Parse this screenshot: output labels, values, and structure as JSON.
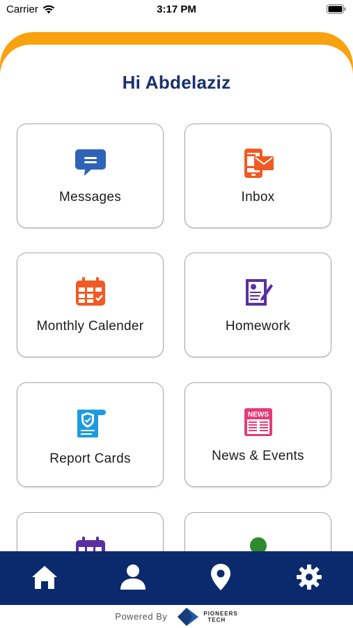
{
  "status_bar": {
    "carrier": "Carrier",
    "time": "3:17 PM"
  },
  "greeting": "Hi Abdelaziz",
  "tiles": [
    {
      "label": "Messages",
      "icon": "message-bubble-icon",
      "color": "#2f63b8"
    },
    {
      "label": "Inbox",
      "icon": "phone-mail-icon",
      "color": "#f15a22"
    },
    {
      "label": "Monthly Calender",
      "icon": "calendar-icon",
      "color": "#f15a22"
    },
    {
      "label": "Homework",
      "icon": "homework-icon",
      "color": "#5b2fa0"
    },
    {
      "label": "Report Cards",
      "icon": "report-card-icon",
      "color": "#1e9be0"
    },
    {
      "label": "News & Events",
      "icon": "newspaper-icon",
      "color": "#e23d78"
    },
    {
      "label": "",
      "icon": "calendar-icon",
      "color": "#5b2fa0"
    },
    {
      "label": "",
      "icon": "person-icon",
      "color": "#2e8b2e"
    }
  ],
  "bottom_nav": [
    {
      "name": "home",
      "icon": "home-icon"
    },
    {
      "name": "profile",
      "icon": "user-icon"
    },
    {
      "name": "location",
      "icon": "location-pin-icon"
    },
    {
      "name": "settings",
      "icon": "gear-icon"
    }
  ],
  "footer": {
    "powered_by": "Powered By",
    "brand_line1": "PIONEERS",
    "brand_line2": "TECH"
  },
  "colors": {
    "accent_orange": "#f9a20f",
    "nav_blue": "#0b2a6e",
    "greeting_blue": "#18306c"
  }
}
